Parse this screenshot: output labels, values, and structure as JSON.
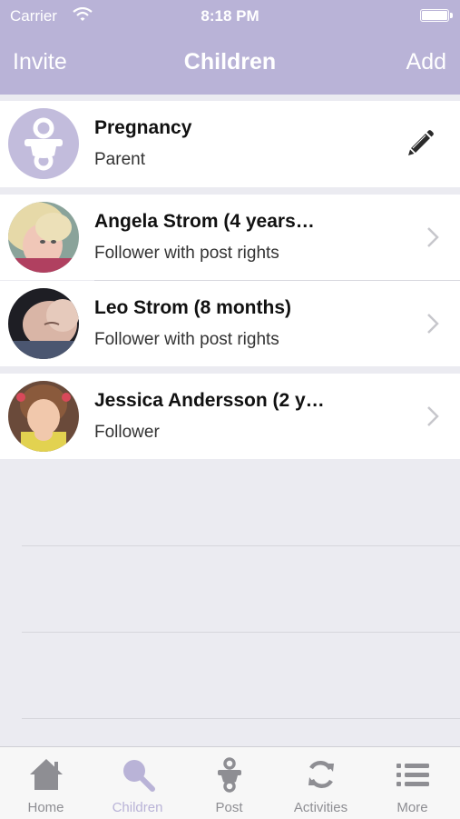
{
  "status_bar": {
    "carrier": "Carrier",
    "time": "8:18 PM"
  },
  "nav": {
    "left": "Invite",
    "title": "Children",
    "right": "Add"
  },
  "pregnancy": {
    "name": "Pregnancy",
    "role": "Parent",
    "icon": "pacifier-icon",
    "action_icon": "pencil-icon"
  },
  "children": [
    {
      "name": "Angela Strom (4 years…",
      "role": "Follower with post rights"
    },
    {
      "name": "Leo Strom (8 months)",
      "role": "Follower with post rights"
    },
    {
      "name": "Jessica Andersson (2 y…",
      "role": "Follower"
    }
  ],
  "tabs": [
    {
      "label": "Home",
      "icon": "home-icon",
      "active": false
    },
    {
      "label": "Children",
      "icon": "search-icon",
      "active": true
    },
    {
      "label": "Post",
      "icon": "pacifier-icon",
      "active": false
    },
    {
      "label": "Activities",
      "icon": "refresh-icon",
      "active": false
    },
    {
      "label": "More",
      "icon": "list-icon",
      "active": false
    }
  ],
  "colors": {
    "accent": "#b9b3d7",
    "background": "#ebebf1",
    "tab_inactive": "#8e8e93"
  }
}
